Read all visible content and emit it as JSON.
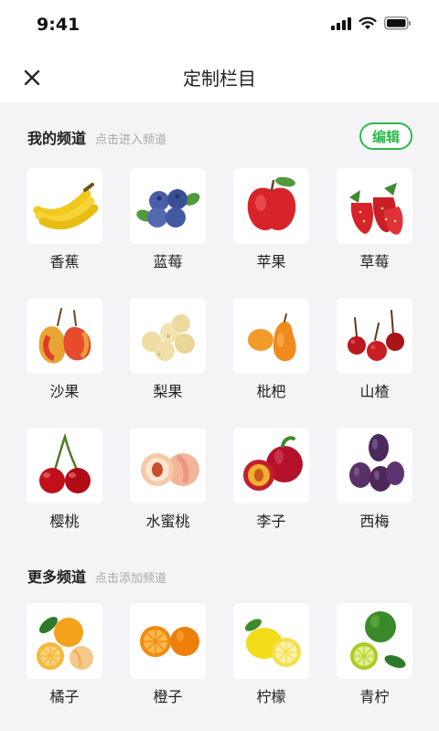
{
  "status_bar": {
    "time": "9:41"
  },
  "nav": {
    "title": "定制栏目"
  },
  "my_channels": {
    "title": "我的频道",
    "hint": "点击进入频道",
    "edit_label": "编辑",
    "items": [
      {
        "label": "香蕉",
        "icon": "banana-icon"
      },
      {
        "label": "蓝莓",
        "icon": "blueberry-icon"
      },
      {
        "label": "苹果",
        "icon": "apple-icon"
      },
      {
        "label": "草莓",
        "icon": "strawberry-icon"
      },
      {
        "label": "沙果",
        "icon": "crabapple-icon"
      },
      {
        "label": "梨果",
        "icon": "pear-icon"
      },
      {
        "label": "枇杷",
        "icon": "loquat-icon"
      },
      {
        "label": "山楂",
        "icon": "hawthorn-icon"
      },
      {
        "label": "樱桃",
        "icon": "cherry-icon"
      },
      {
        "label": "水蜜桃",
        "icon": "peach-icon"
      },
      {
        "label": "李子",
        "icon": "plum-icon"
      },
      {
        "label": "西梅",
        "icon": "prune-icon"
      }
    ]
  },
  "more_channels": {
    "title": "更多频道",
    "hint": "点击添加频道",
    "items": [
      {
        "label": "橘子",
        "icon": "tangerine-icon"
      },
      {
        "label": "橙子",
        "icon": "orange-icon"
      },
      {
        "label": "柠檬",
        "icon": "lemon-icon"
      },
      {
        "label": "青柠",
        "icon": "lime-icon"
      }
    ]
  },
  "colors": {
    "accent": "#2db84d",
    "background": "#f4f4f6",
    "hint": "#a8a8a8"
  }
}
